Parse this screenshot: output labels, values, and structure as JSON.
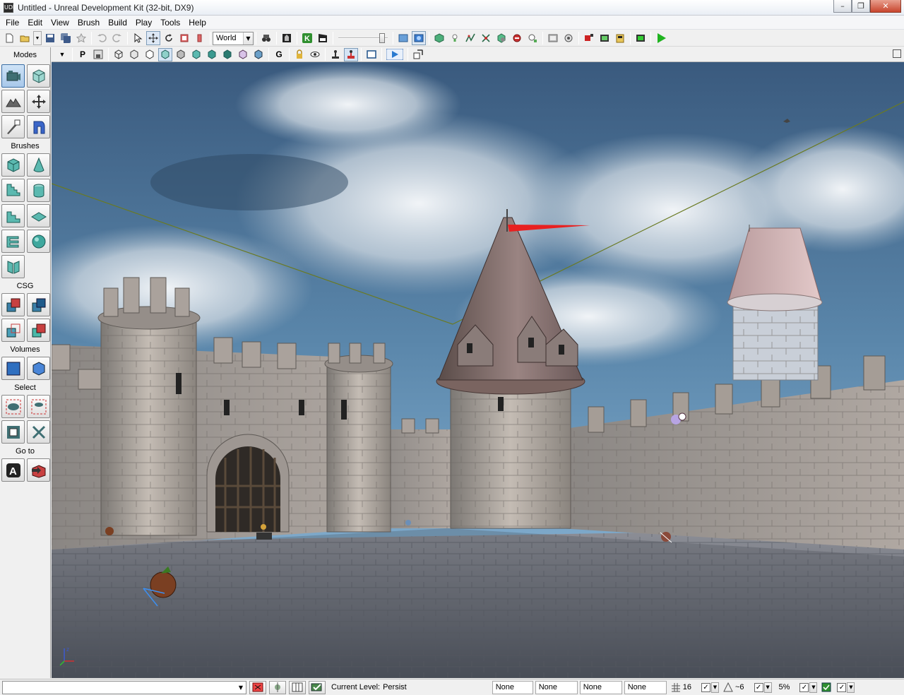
{
  "window": {
    "title": "Untitled - Unreal Development Kit (32-bit, DX9)",
    "app_icon_text": "UDK",
    "minimize": "–",
    "maximize": "❐",
    "close": "✕"
  },
  "menu": [
    "File",
    "Edit",
    "View",
    "Brush",
    "Build",
    "Play",
    "Tools",
    "Help"
  ],
  "toolbar": {
    "coordinate_system": "World",
    "drop_arrow": "▼"
  },
  "modes_panel": {
    "header": "Modes",
    "sections": {
      "brushes": "Brushes",
      "csg": "CSG",
      "volumes": "Volumes",
      "select": "Select",
      "goto": "Go to"
    }
  },
  "viewport_toolbar": {
    "perspective_label": "P",
    "groups_label": "G"
  },
  "statusbar": {
    "current_level_label": "Current Level:",
    "current_level_value": "Persist",
    "fields": [
      "None",
      "None",
      "None",
      "None"
    ],
    "grid_value": "16",
    "rotation_value": "~6",
    "scale_value": "5%",
    "check_mark": "✓",
    "drop_arrow": "▼"
  },
  "colors": {
    "accent_blue": "#3b6ea5",
    "play_green": "#1fb31f",
    "flag_red": "#e82020"
  }
}
